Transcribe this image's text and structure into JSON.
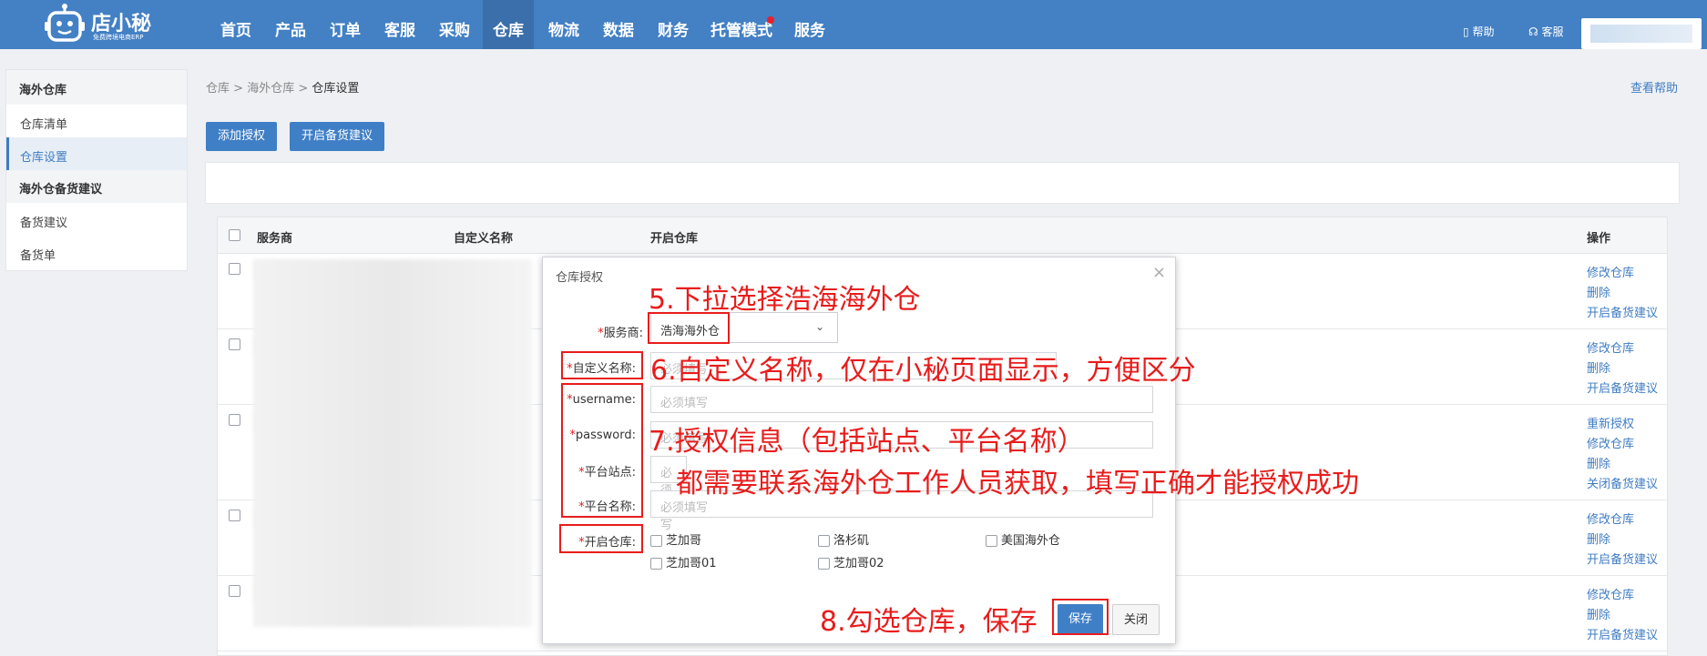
{
  "app": {
    "logo_text": "店小秘",
    "logo_sub": "免费跨境电商ERP"
  },
  "nav": [
    "首页",
    "产品",
    "订单",
    "客服",
    "采购",
    "仓库",
    "物流",
    "数据",
    "财务",
    "托管模式",
    "服务"
  ],
  "nav_active": "仓库",
  "top_links": {
    "help": "帮助",
    "service": "客服"
  },
  "sidebar": {
    "groups": [
      {
        "title": "海外仓库",
        "items": [
          "仓库清单",
          "仓库设置"
        ]
      },
      {
        "title": "海外仓备货建议",
        "items": [
          "备货建议",
          "备货单"
        ]
      }
    ],
    "active_item": "仓库设置"
  },
  "breadcrumb": [
    "仓库",
    "海外仓库",
    "仓库设置"
  ],
  "help_link": "查看帮助",
  "toolbar": {
    "add_auth": "添加授权",
    "enable_stock": "开启备货建议"
  },
  "table": {
    "headers": [
      "服务商",
      "自定义名称",
      "开启仓库",
      "操作"
    ],
    "rows": [
      {
        "ops": [
          "修改仓库",
          "删除",
          "开启备货建议"
        ]
      },
      {
        "ops": [
          "修改仓库",
          "删除",
          "开启备货建议"
        ]
      },
      {
        "ops": [
          "重新授权",
          "修改仓库",
          "删除",
          "关闭备货建议"
        ]
      },
      {
        "ops": [
          "修改仓库",
          "删除",
          "开启备货建议"
        ]
      },
      {
        "ops": [
          "修改仓库",
          "删除",
          "开启备货建议"
        ]
      }
    ]
  },
  "dialog": {
    "title": "仓库授权",
    "close": "×",
    "fields": {
      "provider": {
        "label": "服务商:",
        "value": "浩海海外仓"
      },
      "custom_name": {
        "label": "自定义名称:",
        "placeholder": "必须填写"
      },
      "username": {
        "label": "username:",
        "placeholder": "必须填写"
      },
      "password": {
        "label": "password:",
        "placeholder": "必须填写"
      },
      "site": {
        "label": "平台站点:",
        "placeholder": "必须填写"
      },
      "platform": {
        "label": "平台名称:",
        "placeholder": "必须填写"
      },
      "warehouses_label": "开启仓库:"
    },
    "warehouses": [
      "芝加哥",
      "洛杉矶",
      "美国海外仓",
      "芝加哥01",
      "芝加哥02"
    ],
    "save": "保存",
    "close_btn": "关闭"
  },
  "annotations": {
    "a5": "5.下拉选择浩海海外仓",
    "a6": "6.自定义名称，仅在小秘页面显示，方便区分",
    "a7": "7.授权信息（包括站点、平台名称）",
    "a7b": "都需要联系海外仓工作人员获取，填写正确才能授权成功",
    "a8": "8.勾选仓库，保存"
  },
  "colors": {
    "topbar": "#4380c4",
    "accent": "#3f7fc6",
    "annotation": "#e81c1c"
  }
}
